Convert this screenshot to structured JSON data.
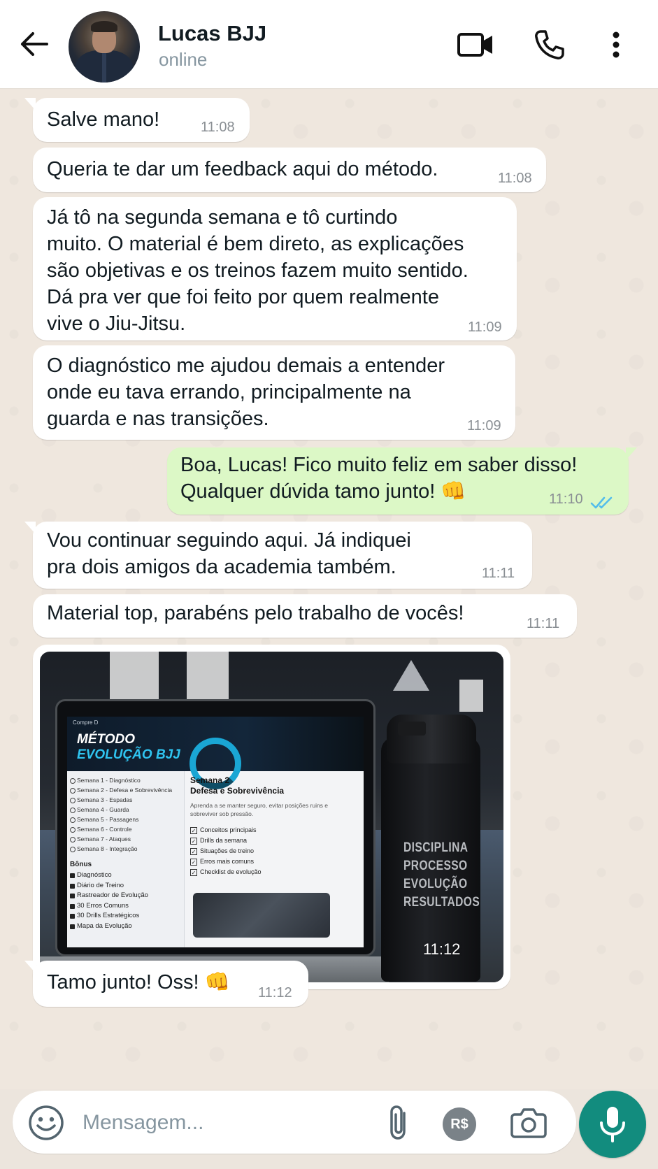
{
  "header": {
    "contact_name": "Lucas BJJ",
    "status": "online"
  },
  "messages": [
    {
      "dir": "in",
      "text": "Salve mano!",
      "time": "11:08"
    },
    {
      "dir": "in",
      "text": "Queria te dar um feedback aqui do método.",
      "time": "11:08"
    },
    {
      "dir": "in",
      "text": "Já tô na segunda semana e tô curtindo\nmuito. O material é bem direto, as explicações\nsão objetivas e os treinos fazem muito sentido.\nDá pra ver que foi feito por quem realmente\nvive o Jiu-Jitsu.",
      "time": "11:09"
    },
    {
      "dir": "in",
      "text": "O diagnóstico me ajudou demais a entender\nonde eu tava errando, principalmente na\nguarda e nas transições.",
      "time": "11:09"
    },
    {
      "dir": "out",
      "text": "Boa, Lucas! Fico muito feliz em saber disso!\nQualquer dúvida tamo junto! 👊",
      "time": "11:10",
      "status": "read"
    },
    {
      "dir": "in",
      "text": "Vou continuar seguindo aqui. Já indiquei\npra dois amigos da academia também.",
      "time": "11:11"
    },
    {
      "dir": "in",
      "text": "Material top, parabéns pelo trabalho de vocês!",
      "time": "11:11"
    },
    {
      "dir": "in",
      "type": "image",
      "time": "11:12"
    },
    {
      "dir": "in",
      "text": "Tamo junto! Oss! 👊",
      "time": "11:12"
    }
  ],
  "image_content": {
    "app_label": "Compre D",
    "title_line1": "MÉTODO",
    "title_line2": "EVOLUÇÃO BJJ",
    "weeks": [
      "Semana 1 - Diagnóstico",
      "Semana 2 - Defesa e Sobrevivência",
      "Semana 3 - Espadas",
      "Semana 4 - Guarda",
      "Semana 5 - Passagens",
      "Semana 6 - Controle",
      "Semana 7 - Ataques",
      "Semana 8 - Integração"
    ],
    "bonus_heading": "Bônus",
    "bonus_items": [
      "Diagnóstico",
      "Diário de Treino",
      "Rastreador de Evolução",
      "30 Erros Comuns",
      "30 Drills Estratégicos",
      "Mapa da Evolução"
    ],
    "main_week": "Semana 2",
    "main_subtitle": "Defesa e Sobrevivência",
    "main_description": "Aprenda a se manter seguro, evitar posições ruins e sobreviver sob pressão.",
    "checklist": [
      "Conceitos principais",
      "Drills da semana",
      "Situações de treino",
      "Erros mais comuns",
      "Checklist de evolução"
    ],
    "bottle_text": [
      "DISCIPLINA",
      "PROCESSO",
      "EVOLUÇÃO",
      "RESULTADOS"
    ]
  },
  "composer": {
    "placeholder": "Mensagem...",
    "pix_label": "R$"
  },
  "colors": {
    "incoming_bubble": "#ffffff",
    "outgoing_bubble": "#dcf8c6",
    "mic_button": "#128c7e",
    "read_ticks": "#53bdeb"
  },
  "icons": [
    "back-arrow-icon",
    "video-call-icon",
    "phone-icon",
    "more-options-icon",
    "emoji-icon",
    "attach-icon",
    "camera-icon",
    "mic-icon"
  ]
}
